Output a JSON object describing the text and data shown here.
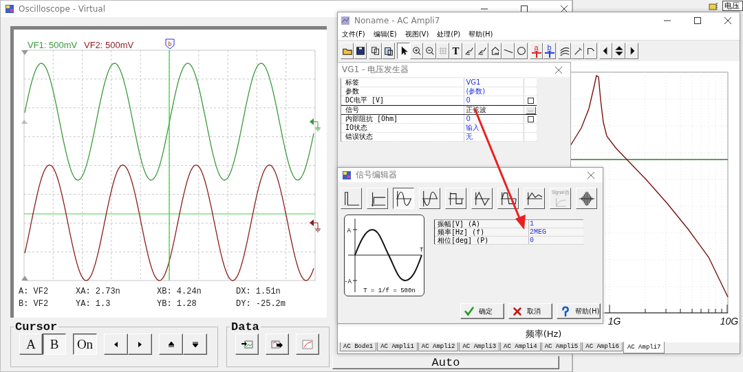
{
  "scope_window": {
    "title": "Oscilloscope - Virtual",
    "channels": [
      {
        "label": "VF1: 500mV",
        "color": "#3a9a3a"
      },
      {
        "label": "VF2: 500mV",
        "color": "#8c1c1c"
      }
    ],
    "cursor_marker": "b",
    "readouts": [
      [
        "A: VF2",
        "XA: 2.73n",
        "XB: 4.24n",
        "DX: 1.51n"
      ],
      [
        "B: VF2",
        "YA: 1.3",
        "YB: 1.28",
        "DY: -25.2m"
      ]
    ],
    "cursor_group": {
      "title": "Cursor",
      "ab_buttons": [
        {
          "label": "A",
          "selected": false
        },
        {
          "label": "B",
          "selected": true
        }
      ],
      "on_button": {
        "label": "On",
        "selected": true
      }
    },
    "data_group": {
      "title": "Data"
    },
    "auto_button": "Auto"
  },
  "back_window": {
    "label": "电压"
  },
  "ac_window": {
    "title": "Noname - AC Ampli7",
    "menu": [
      "文件(F)",
      "编辑(E)",
      "视图(V)",
      "处理(P)",
      "帮助(H)"
    ],
    "toolbar": [
      [
        {
          "kind": "open",
          "disabled": false
        },
        {
          "kind": "save",
          "disabled": false
        }
      ],
      [
        {
          "kind": "copy",
          "disabled": false
        },
        {
          "kind": "paste",
          "disabled": false
        }
      ],
      [
        {
          "kind": "pointer",
          "disabled": false,
          "selected": true
        },
        {
          "kind": "zoom-in",
          "disabled": false
        },
        {
          "kind": "zoom-out",
          "disabled": false
        },
        {
          "kind": "grid",
          "disabled": true
        },
        {
          "kind": "text",
          "disabled": false,
          "label": "T"
        },
        {
          "kind": "probe",
          "disabled": false
        },
        {
          "kind": "probe",
          "disabled": false
        },
        {
          "kind": "probe-box",
          "disabled": false
        },
        {
          "kind": "line",
          "disabled": false
        },
        {
          "kind": "circle",
          "disabled": false
        }
      ],
      [
        {
          "kind": "cursor",
          "disabled": false,
          "label": "a",
          "color": "#e02020"
        },
        {
          "kind": "cursor",
          "disabled": false,
          "label": "b",
          "color": "#2040e0"
        }
      ],
      [
        {
          "kind": "add-trace",
          "disabled": false
        },
        {
          "kind": "dropper",
          "disabled": false
        },
        {
          "kind": "corner",
          "disabled": false
        }
      ],
      [
        {
          "kind": "left",
          "disabled": false
        },
        {
          "kind": "up-down",
          "disabled": false
        },
        {
          "kind": "right",
          "disabled": false
        }
      ]
    ],
    "plot": {
      "x_tick_labels": [
        "1G",
        "10G"
      ],
      "xlabel": "频率(Hz)"
    },
    "tabs": [
      {
        "label": "AC Bode1",
        "selected": false
      },
      {
        "label": "AC Ampli1",
        "selected": false
      },
      {
        "label": "AC Ampli2",
        "selected": false
      },
      {
        "label": "AC Ampli3",
        "selected": false
      },
      {
        "label": "AC Ampli4",
        "selected": false
      },
      {
        "label": "AC Ampli5",
        "selected": false
      },
      {
        "label": "AC Ampli6",
        "selected": false
      },
      {
        "label": "AC Ampli7",
        "selected": true
      }
    ]
  },
  "property_dialog": {
    "title": "VG1 - 电压发生器",
    "rows": [
      {
        "kind": "text",
        "label": "标签",
        "value": "VG1"
      },
      {
        "kind": "text",
        "label": "参数",
        "value": "(参数)"
      },
      {
        "kind": "check",
        "label": "DC电平 [V]",
        "value": "0",
        "checked": false
      },
      {
        "kind": "edit",
        "label": "信号",
        "value": "正弦波",
        "more": "..."
      },
      {
        "kind": "check",
        "label": "内部阻抗 [Ohm]",
        "value": "0",
        "checked": false
      },
      {
        "kind": "text",
        "label": "IO状态",
        "value": "输入"
      },
      {
        "kind": "text",
        "label": "错误状态",
        "value": "无"
      }
    ]
  },
  "signal_editor": {
    "title": "信号编辑器",
    "waveforms": [
      {
        "kind": "pulse",
        "selected": false,
        "disabled": false
      },
      {
        "kind": "step",
        "selected": false,
        "disabled": false
      },
      {
        "kind": "sine",
        "selected": true,
        "disabled": false
      },
      {
        "kind": "sine-neg",
        "selected": false,
        "disabled": false
      },
      {
        "kind": "square",
        "selected": false,
        "disabled": false
      },
      {
        "kind": "triangle",
        "selected": false,
        "disabled": false
      },
      {
        "kind": "trapezoid",
        "selected": false,
        "disabled": false
      },
      {
        "kind": "pwl",
        "selected": false,
        "disabled": false
      },
      {
        "kind": "exp",
        "selected": false,
        "disabled": true,
        "label": "Signal (t)"
      },
      {
        "kind": "burst",
        "selected": false,
        "disabled": false
      }
    ],
    "preview": {
      "amplitude_label": "A",
      "neg_amplitude_label": "-A",
      "period_label": "T",
      "formula": "T = 1/f = 500n"
    },
    "params": [
      {
        "label": "振幅[V] (A)",
        "value": "1"
      },
      {
        "label": "频率[Hz] (f)",
        "value": "2MEG"
      },
      {
        "label": "相位[deg] (P)",
        "value": "0"
      }
    ],
    "buttons": [
      {
        "kind": "ok",
        "label": "确定"
      },
      {
        "kind": "cancel",
        "label": "取消"
      },
      {
        "kind": "help",
        "label": "帮助(H)"
      }
    ]
  }
}
